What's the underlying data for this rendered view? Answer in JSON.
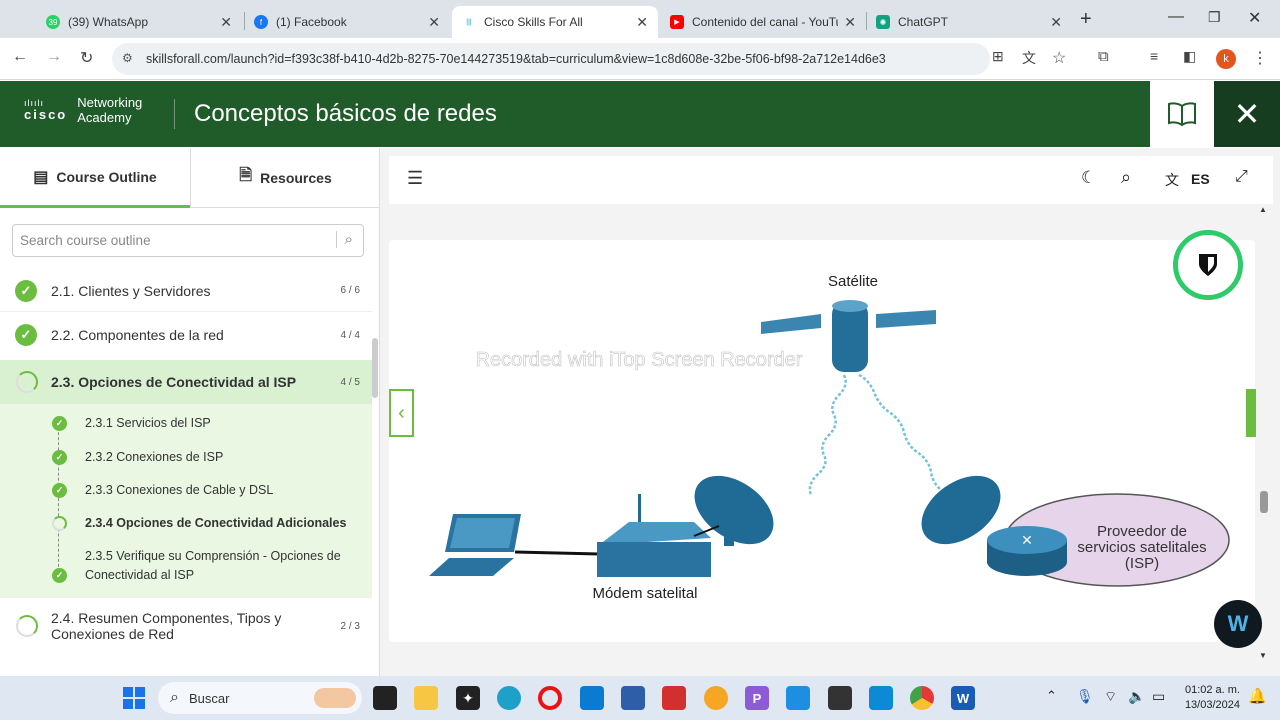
{
  "browser": {
    "tabs": [
      {
        "title": "(39) WhatsApp",
        "badge": "39",
        "color": "#25d366"
      },
      {
        "title": "(1) Facebook",
        "color": "#1877f2"
      },
      {
        "title": "Cisco Skills For All",
        "color": "#049fd9"
      },
      {
        "title": "Contenido del canal - YouTu",
        "color": "#ff0000"
      },
      {
        "title": "ChatGPT",
        "color": "#10a37f"
      }
    ],
    "new_tab_icon": "+",
    "url": "skillsforall.com/launch?id=f393c38f-b410-4d2b-8275-70e144273519&tab=curriculum&view=1c8d608e-32be-5f06-bf98-2a712e14d6e3",
    "profile_initial": "k"
  },
  "header": {
    "logo_brand": "cisco",
    "logo_line1": "Networking",
    "logo_line2": "Academy",
    "course_title": "Conceptos básicos de redes",
    "colors": {
      "bar": "#205c2a",
      "close": "#163d1f"
    }
  },
  "sidebar": {
    "tabs": [
      {
        "label": "Course Outline"
      },
      {
        "label": "Resources"
      }
    ],
    "search_placeholder": "Search course outline",
    "modules": [
      {
        "label": "2.1. Clientes y Servidores",
        "count": "6 / 6",
        "status": "done"
      },
      {
        "label": "2.2. Componentes de la red",
        "count": "4 / 4",
        "status": "done"
      },
      {
        "label": "2.3. Opciones de Conectividad al ISP",
        "count": "4 / 5",
        "status": "partial"
      },
      {
        "label": "2.4. Resumen Componentes, Tipos y Conexiones de Red",
        "count": "2 / 3",
        "status": "partial"
      }
    ],
    "subitems": [
      {
        "label": "2.3.1 Servicios del ISP",
        "status": "done"
      },
      {
        "label": "2.3.2 Conexiones de ISP",
        "status": "done"
      },
      {
        "label": "2.3.3 Conexiones de Cable y DSL",
        "status": "done"
      },
      {
        "label": "2.3.4 Opciones de Conectividad Adicionales",
        "status": "current"
      },
      {
        "label": "2.3.5 Verifique su Comprensión - Opciones de Conectividad al ISP",
        "status": "done"
      }
    ]
  },
  "toolbar": {
    "language": "ES"
  },
  "diagram": {
    "satellite_label": "Satélite",
    "modem_label": "Módem satelital",
    "isp_line1": "Proveedor de",
    "isp_line2": "servicios satelitales",
    "isp_line3": "(ISP)",
    "watermark": "Recorded with iTop Screen Recorder"
  },
  "taskbar": {
    "search_placeholder": "Buscar",
    "time": "01:02 a. m.",
    "date": "13/03/2024"
  }
}
